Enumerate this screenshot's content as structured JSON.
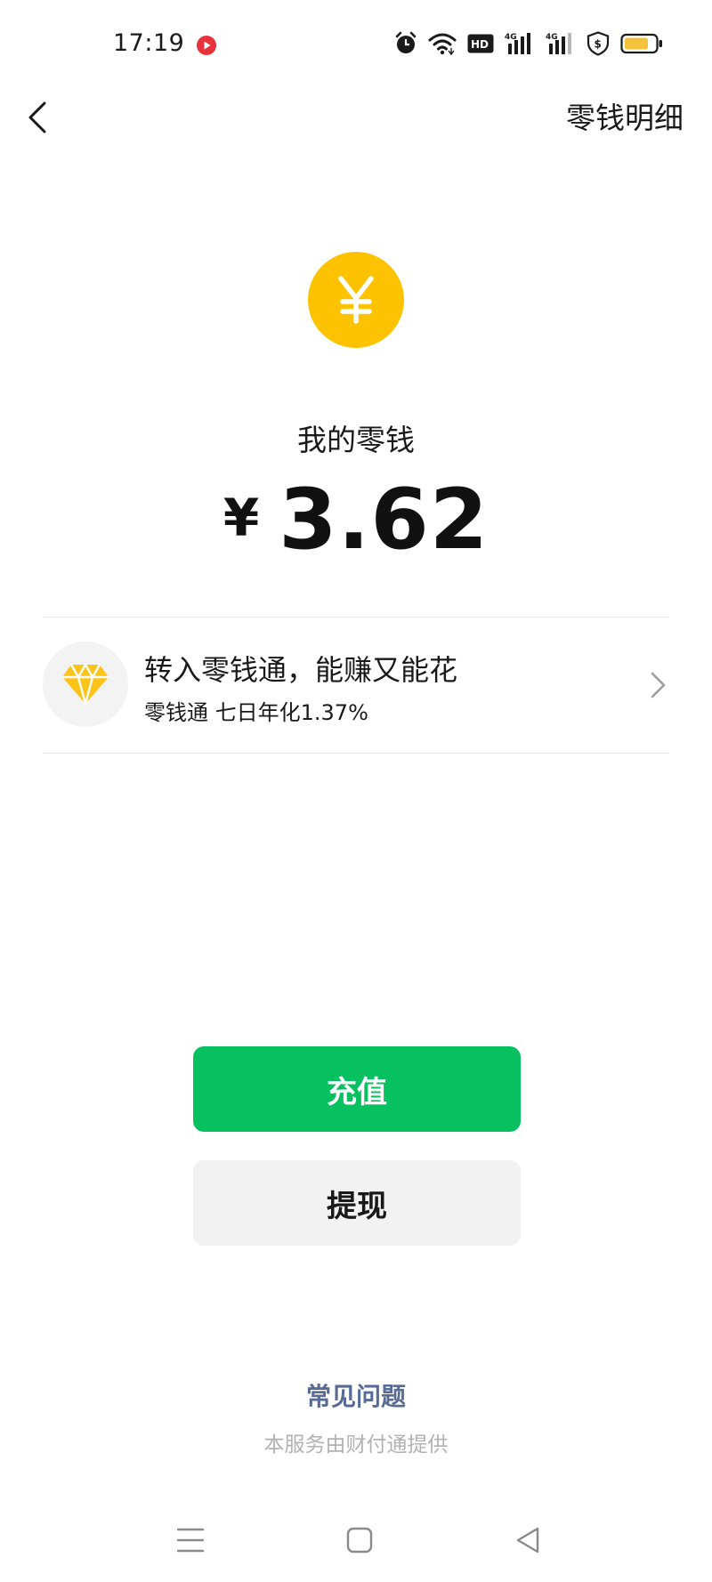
{
  "status_bar": {
    "time": "17:19",
    "icons": [
      "record-icon",
      "alarm-icon",
      "wifi-icon",
      "hd-icon",
      "signal-4g-icon",
      "signal-4g-icon",
      "shield-icon",
      "battery-icon"
    ]
  },
  "header": {
    "back_icon": "chevron-left-icon",
    "details_label": "零钱明细"
  },
  "balance": {
    "coin_glyph": "¥",
    "title": "我的零钱",
    "currency": "¥",
    "amount": "3.62"
  },
  "promo": {
    "icon": "diamond-icon",
    "title": "转入零钱通，能赚又能花",
    "subtitle": "零钱通 七日年化1.37%"
  },
  "actions": {
    "recharge_label": "充值",
    "withdraw_label": "提现"
  },
  "footer": {
    "faq_label": "常见问题",
    "provider_text": "本服务由财付通提供"
  },
  "nav_bar": {
    "icons": [
      "menu-icon",
      "home-icon",
      "back-icon"
    ]
  },
  "colors": {
    "accent_green": "#07c160",
    "coin_yellow": "#fdc300",
    "link_blue": "#576b95",
    "muted_text": "#b2b2b2",
    "battery_yellow": "#f5c33b",
    "record_red": "#e8333b"
  }
}
